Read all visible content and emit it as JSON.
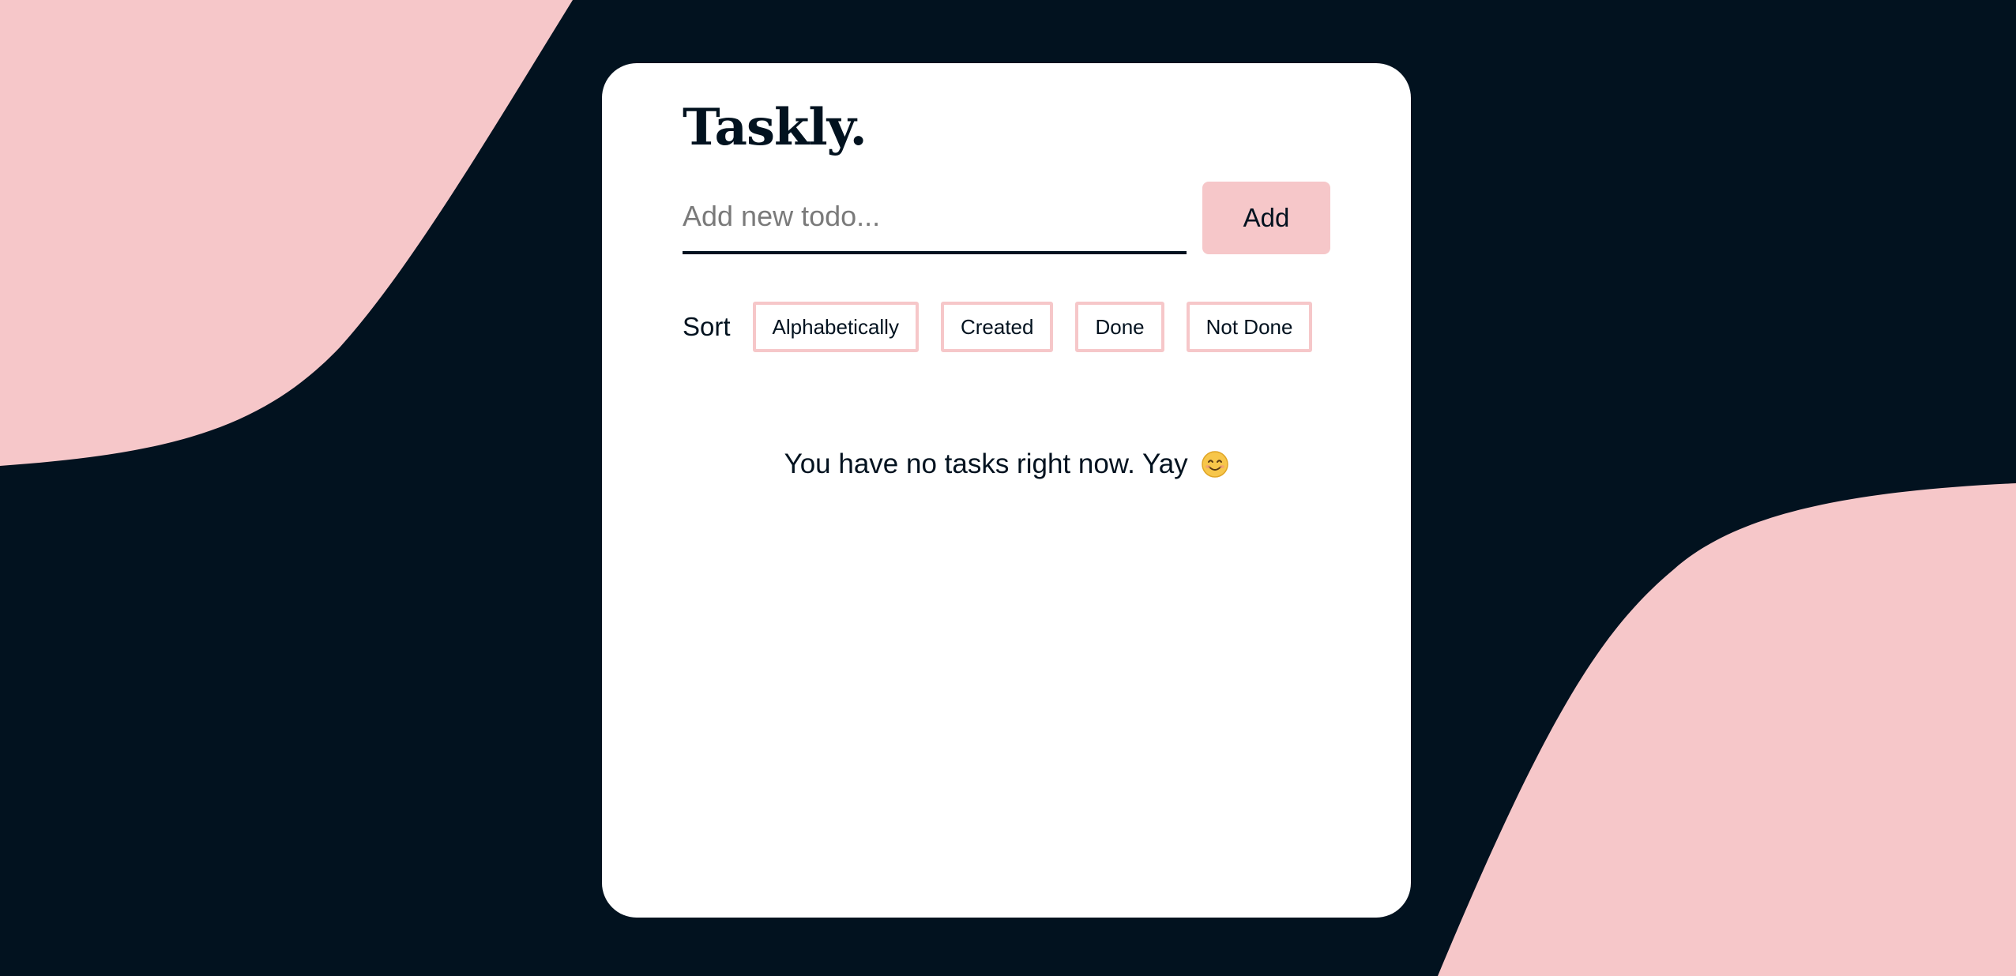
{
  "app": {
    "title": "Taskly."
  },
  "colors": {
    "background": "#02121f",
    "accent": "#f6c7c9",
    "card": "#ffffff",
    "text": "#02121f"
  },
  "new_todo": {
    "placeholder": "Add new todo...",
    "value": "",
    "add_label": "Add"
  },
  "sort": {
    "label": "Sort",
    "options": [
      "Alphabetically",
      "Created",
      "Done",
      "Not Done"
    ]
  },
  "tasks": {
    "items": [],
    "empty_message": "You have no tasks right now. Yay",
    "empty_icon": "smiling-face-icon"
  }
}
